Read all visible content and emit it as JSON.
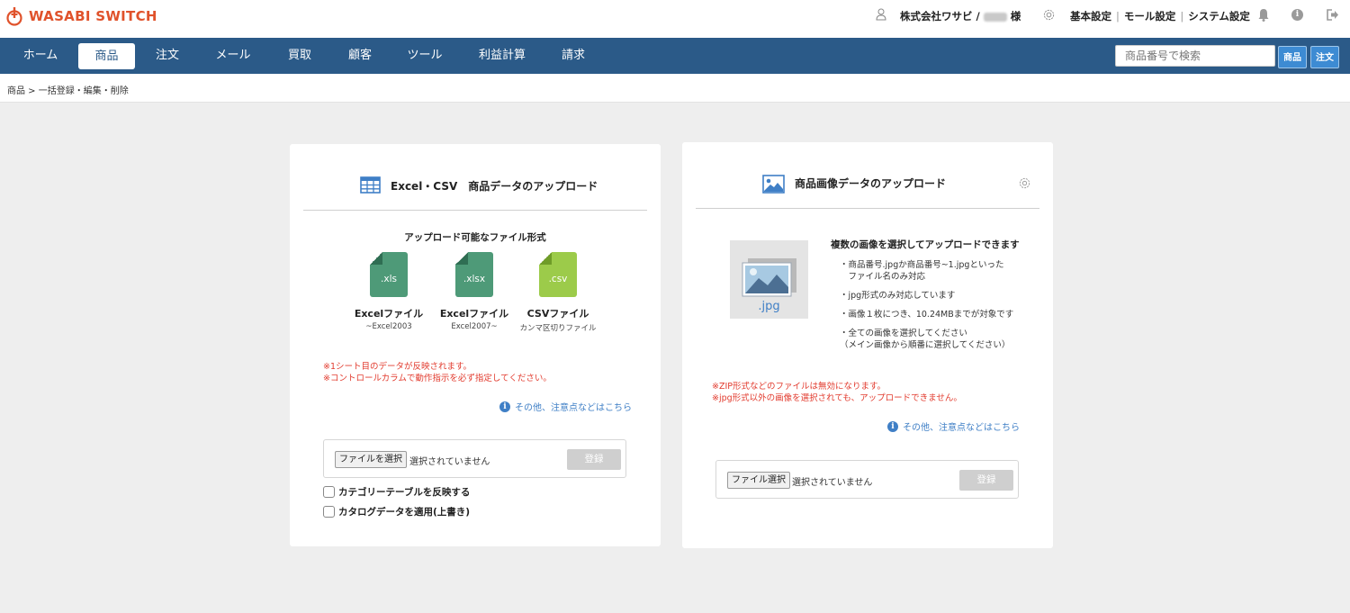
{
  "header": {
    "logo_text": "WASABI SWITCH",
    "company": "株式会社ワサビ /",
    "honorific": "様",
    "links": [
      "基本設定",
      "モール設定",
      "システム設定"
    ],
    "icons": [
      "user-icon",
      "gear-icon",
      "bell-icon",
      "info-icon",
      "logout-icon"
    ]
  },
  "nav": {
    "items": [
      "ホーム",
      "商品",
      "注文",
      "メール",
      "買取",
      "顧客",
      "ツール",
      "利益計算",
      "請求"
    ],
    "active": "商品",
    "search_placeholder": "商品番号で検索",
    "btn_product": "商品",
    "btn_order": "注文"
  },
  "breadcrumb": "商品 > 一括登録・編集・削除",
  "excel_card": {
    "title": "Excel・CSV　商品データのアップロード",
    "formats_heading": "アップロード可能なファイル形式",
    "formats": [
      {
        "ext": ".xls",
        "label": "Excelファイル",
        "sub": "~Excel2003",
        "color": "#4e9a78"
      },
      {
        "ext": ".xlsx",
        "label": "Excelファイル",
        "sub": "Excel2007~",
        "color": "#4e9a78"
      },
      {
        "ext": ".csv",
        "label": "CSVファイル",
        "sub": "カンマ区切りファイル",
        "color": "#9ccb4a"
      }
    ],
    "notes": [
      "※1シート目のデータが反映されます。",
      "※コントロールカラムで動作指示を必ず指定してください。"
    ],
    "info_link": "その他、注意点などはこちら",
    "choose_label": "ファイルを選択",
    "choose_status": "選択されていません",
    "submit_label": "登録",
    "checkboxes": [
      "カテゴリーテーブルを反映する",
      "カタログデータを適用(上書き)"
    ]
  },
  "image_card": {
    "title": "商品画像データのアップロード",
    "thumb_ext": ".jpg",
    "heading": "複数の画像を選択してアップロードできます",
    "bullets": [
      [
        "・商品番号.jpgか商品番号~1.jpgといった",
        "　ファイル名のみ対応"
      ],
      [
        "・jpg形式のみ対応しています"
      ],
      [
        "・画像１枚につき、10.24MBまでが対象です"
      ],
      [
        "・全ての画像を選択してください",
        "（メイン画像から順番に選択してください）"
      ]
    ],
    "notes": [
      "※ZIP形式などのファイルは無効になります。",
      "※jpg形式以外の画像を選択されても、アップロードできません。"
    ],
    "info_link": "その他、注意点などはこちら",
    "choose_label": "ファイル選択",
    "choose_status": "選択されていません",
    "submit_label": "登録"
  }
}
